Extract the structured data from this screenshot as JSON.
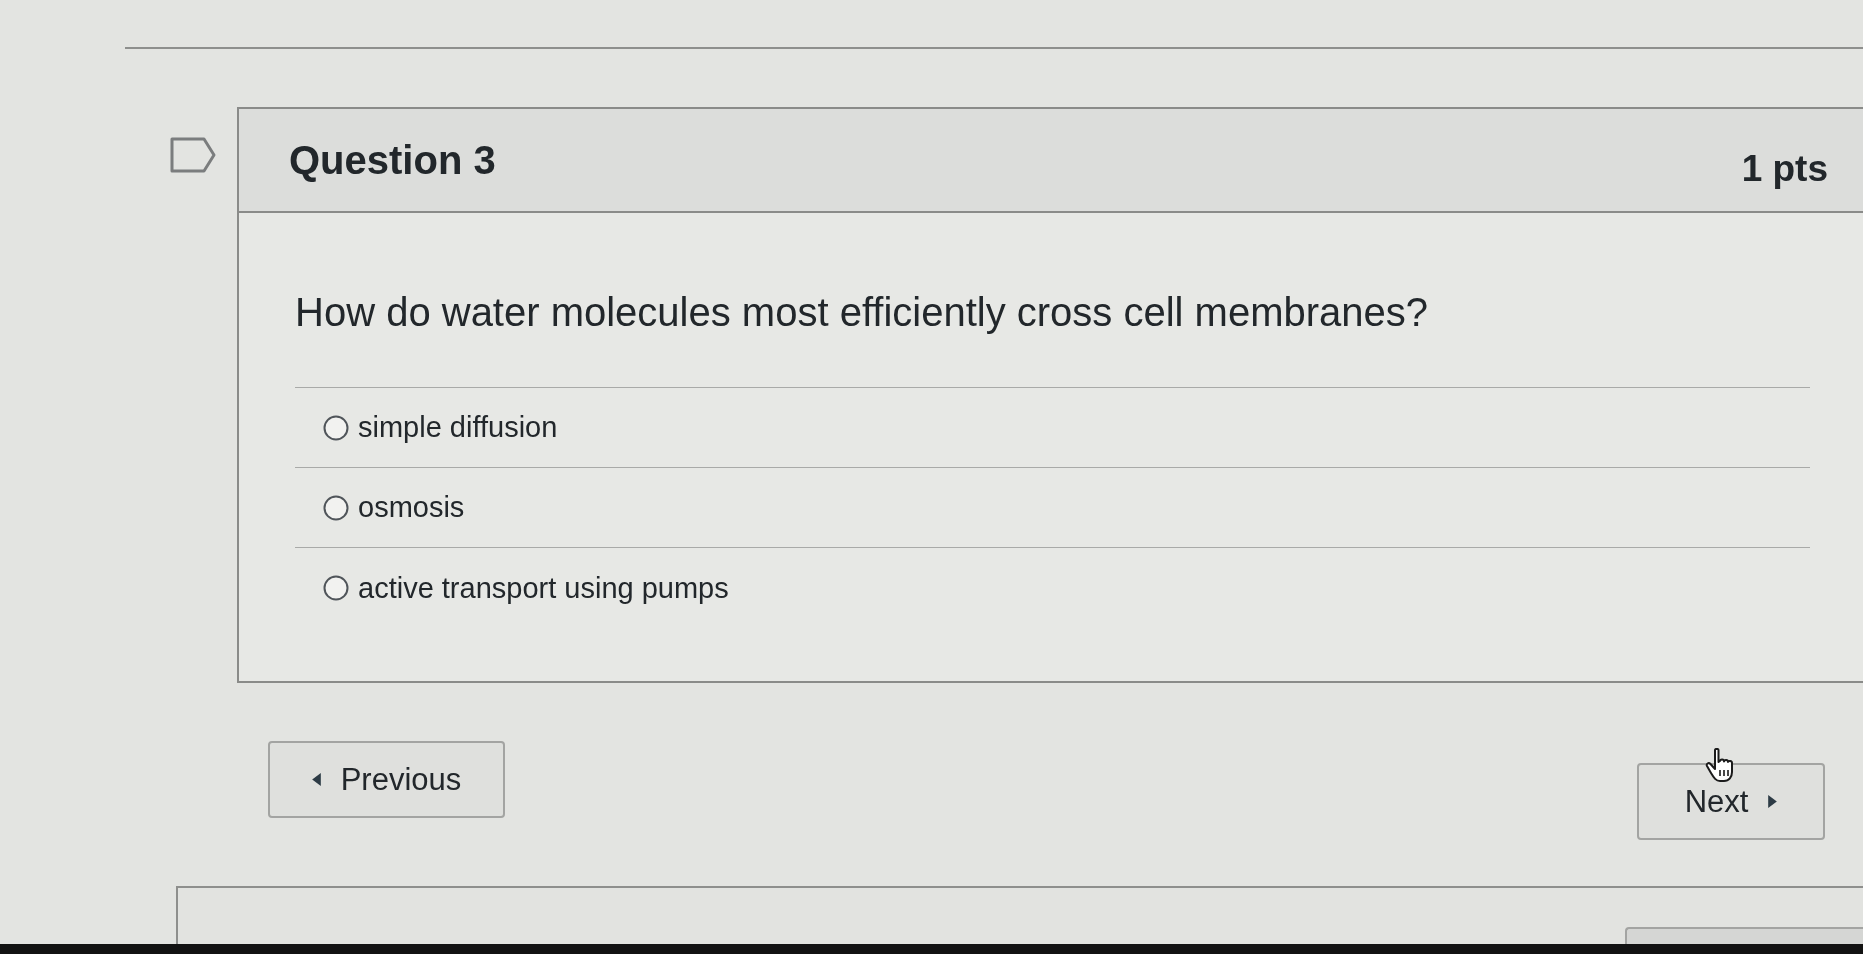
{
  "question": {
    "title": "Question 3",
    "points": "1 pts",
    "flagged": false,
    "text": "How do water molecules most efficiently cross cell membranes?"
  },
  "answers": [
    {
      "label": "simple diffusion",
      "selected": false
    },
    {
      "label": "osmosis",
      "selected": false
    },
    {
      "label": "active transport using pumps",
      "selected": false
    }
  ],
  "navigation": {
    "previous": "Previous",
    "next": "Next"
  }
}
